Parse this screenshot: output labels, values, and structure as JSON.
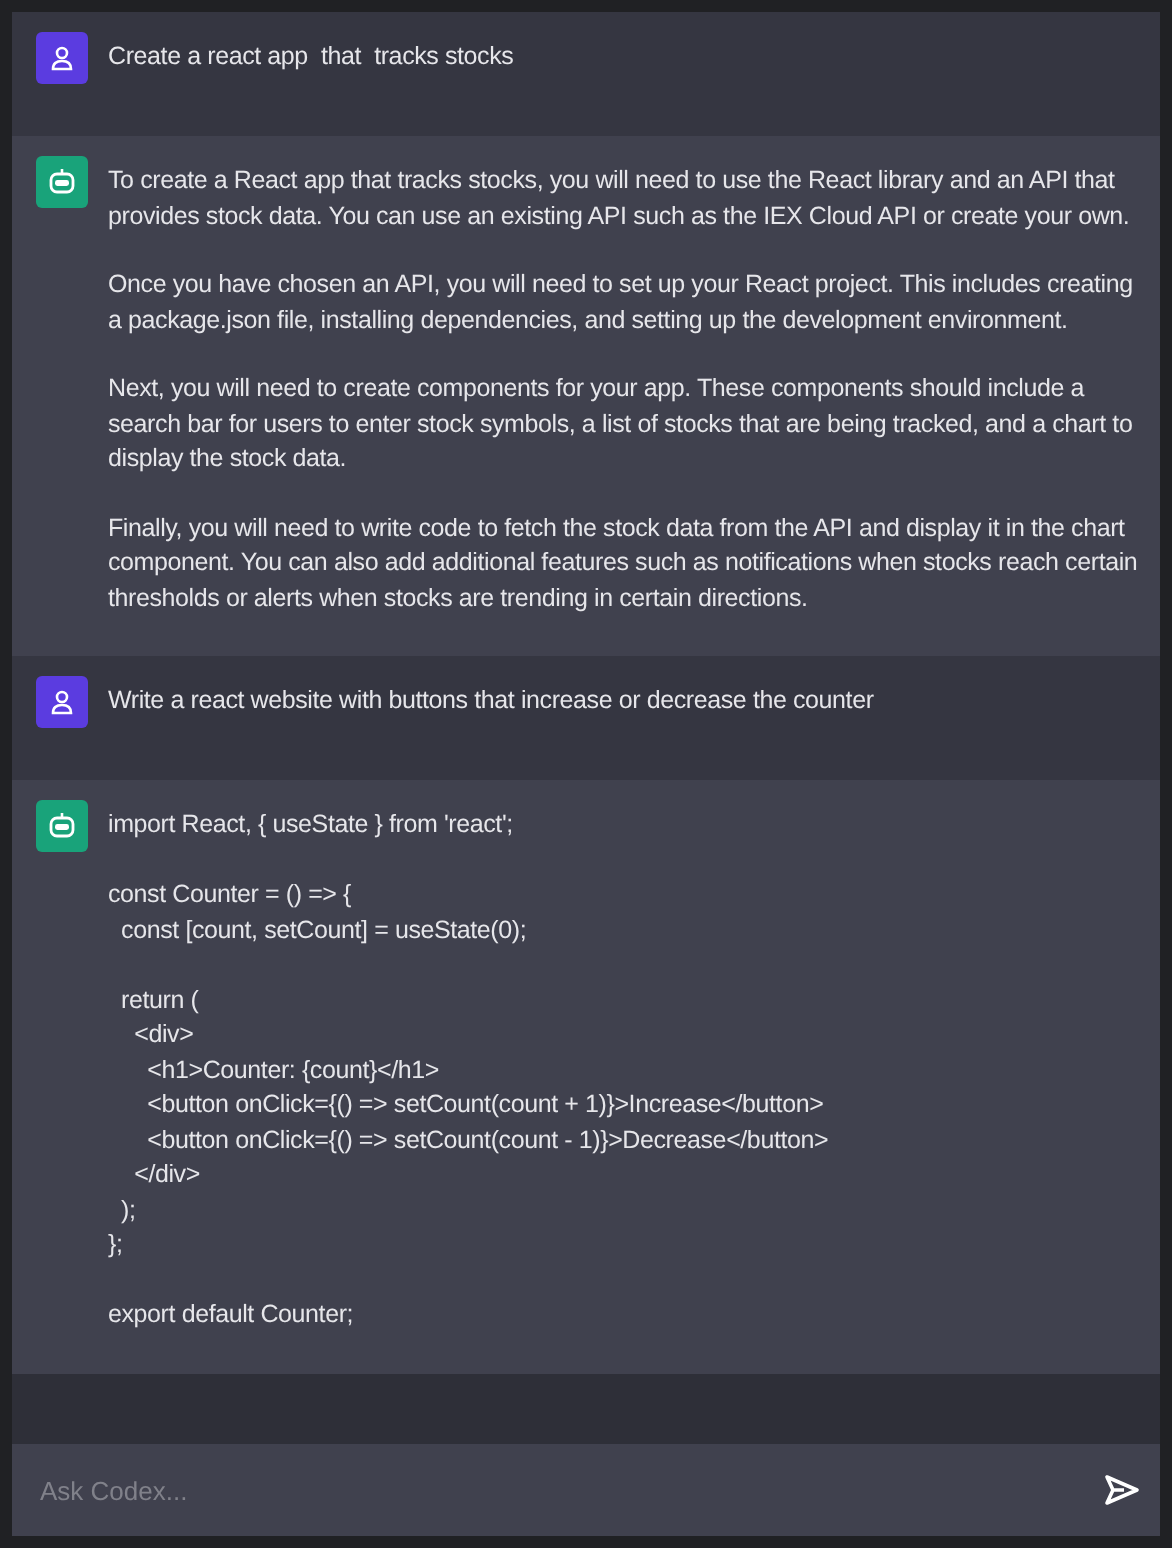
{
  "messages": [
    {
      "kind": "user",
      "paragraphs": [
        "Create a react app  that  tracks stocks"
      ]
    },
    {
      "kind": "bot",
      "paragraphs": [
        "To create a React app that tracks stocks, you will need to use the React library and an API that provides stock data. You can use an existing API such as the IEX Cloud API or create your own.",
        "Once you have chosen an API, you will need to set up your React project. This includes creating a package.json file, installing dependencies, and setting up the development environment.",
        "Next, you will need to create components for your app. These components should include a search bar for users to enter stock symbols, a list of stocks that are being tracked, and a chart to display the stock data.",
        "Finally, you will need to write code to fetch the stock data from the API and display it in the chart component. You can also add additional features such as notifications when stocks reach certain thresholds or alerts when stocks are trending in certain directions."
      ]
    },
    {
      "kind": "user",
      "paragraphs": [
        "Write a react website with buttons that increase or decrease the counter"
      ]
    },
    {
      "kind": "bot",
      "code": "import React, { useState } from 'react';\n\nconst Counter = () => {\n  const [count, setCount] = useState(0);\n\n  return (\n    <div>\n      <h1>Counter: {count}</h1>\n      <button onClick={() => setCount(count + 1)}>Increase</button>\n      <button onClick={() => setCount(count - 1)}>Decrease</button>\n    </div>\n  );\n};\n\nexport default Counter;"
    }
  ],
  "input": {
    "placeholder": "Ask Codex..."
  }
}
